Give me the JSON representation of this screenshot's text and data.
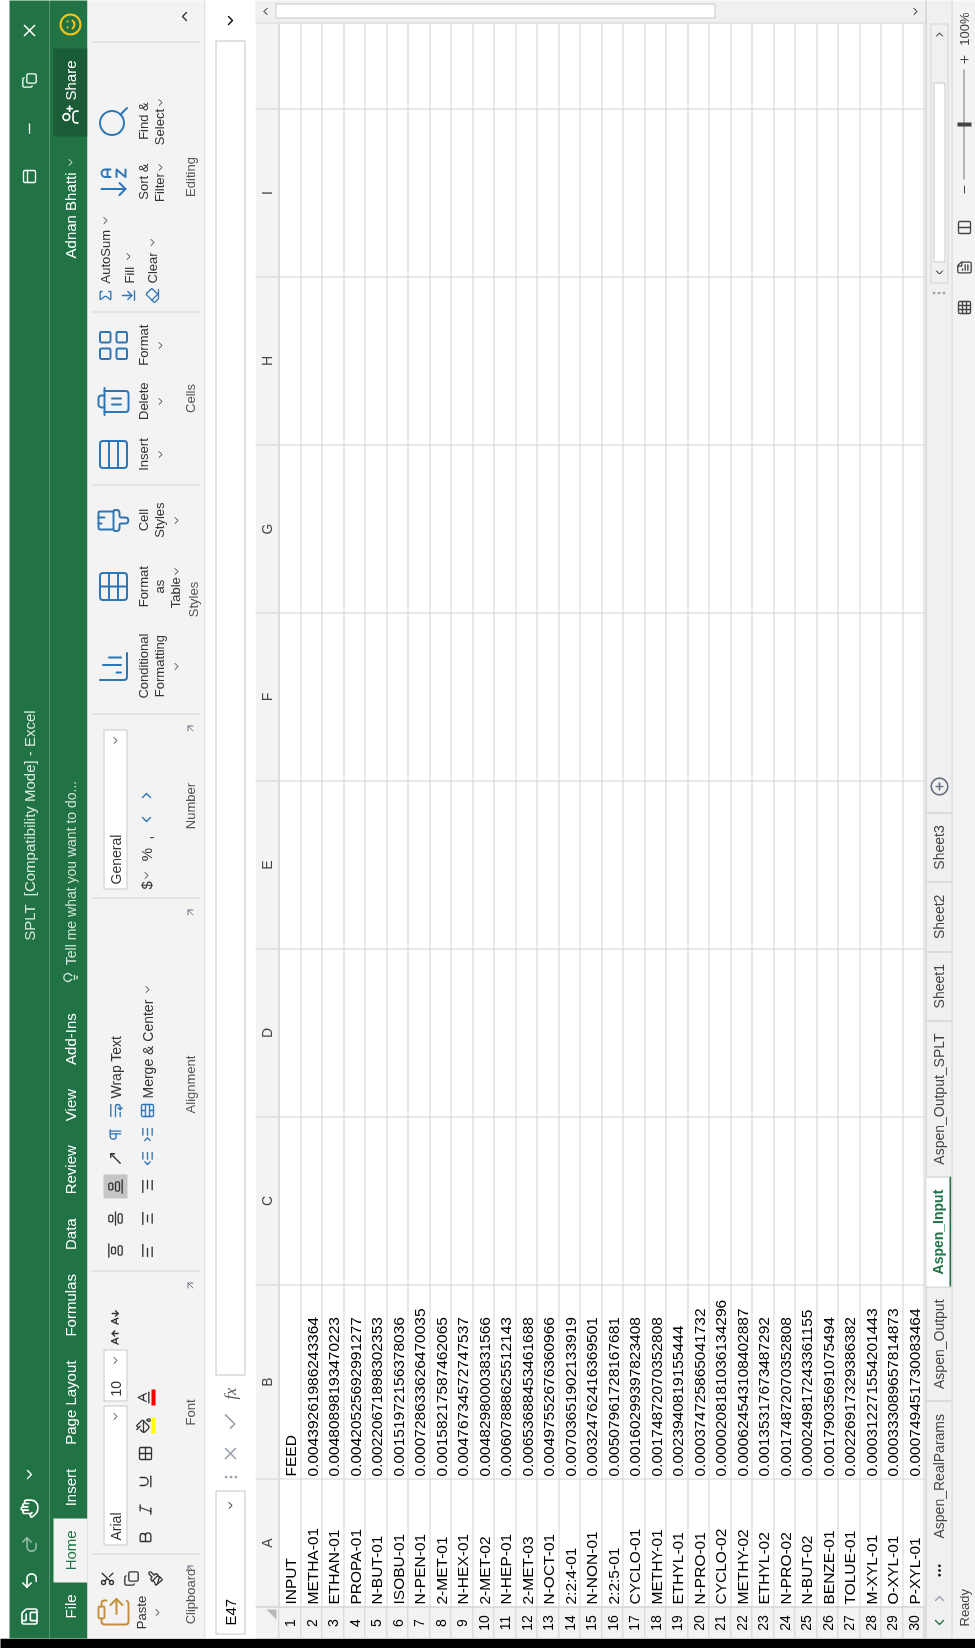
{
  "title_bar": {
    "title": "SPLT  [Compatibility Mode] - Excel"
  },
  "menu_tabs": [
    {
      "label": "File",
      "selected": false
    },
    {
      "label": "Home",
      "selected": true
    },
    {
      "label": "Insert",
      "selected": false
    },
    {
      "label": "Page Layout",
      "selected": false
    },
    {
      "label": "Formulas",
      "selected": false
    },
    {
      "label": "Data",
      "selected": false
    },
    {
      "label": "Review",
      "selected": false
    },
    {
      "label": "View",
      "selected": false
    },
    {
      "label": "Add-Ins",
      "selected": false
    }
  ],
  "tell_me": {
    "placeholder": "Tell me what you want to do..."
  },
  "user": {
    "name": "Adnan Bhatti"
  },
  "share_button": {
    "label": "Share"
  },
  "ribbon": {
    "clipboard": {
      "paste": "Paste",
      "label": "Clipboard"
    },
    "font": {
      "font_name": "Arial",
      "font_size": "10",
      "label": "Font"
    },
    "alignment": {
      "vertical_align": [
        {
          "selected": false
        },
        {
          "selected": false
        },
        {
          "selected": true
        }
      ],
      "wrap_text": "Wrap Text",
      "merge": "Merge & Center",
      "label": "Alignment"
    },
    "number": {
      "format": "General",
      "symbols": [
        "$",
        "%",
        ","
      ],
      "label": "Number"
    },
    "styles": {
      "buttons": [
        {
          "lines": [
            "Conditional",
            "Formatting"
          ]
        },
        {
          "lines": [
            "Format as",
            "Table"
          ]
        },
        {
          "lines": [
            "Cell",
            "Styles"
          ]
        }
      ],
      "label": "Styles"
    },
    "cells": {
      "buttons": [
        "Insert",
        "Delete",
        "Format"
      ],
      "label": "Cells"
    },
    "editing": {
      "small": [
        "AutoSum",
        "Fill",
        "Clear"
      ],
      "buttons": [
        {
          "lines": [
            "Sort &",
            "Filter"
          ]
        },
        {
          "lines": [
            "Find &",
            "Select"
          ]
        }
      ],
      "label": "Editing"
    }
  },
  "formula_bar": {
    "name_box": "E47",
    "function_label": "fx"
  },
  "columns": [
    "A",
    "B",
    "C",
    "D",
    "E",
    "F",
    "G",
    "H",
    "I"
  ],
  "rows": [
    {
      "number": "1",
      "col_a": "INPUT",
      "col_b": "FEED"
    },
    {
      "number": "2",
      "col_a": "METHA-01",
      "col_b": "0.00439261986243364"
    },
    {
      "number": "3",
      "col_a": "ETHAN-01",
      "col_b": "0.00480898193470223"
    },
    {
      "number": "4",
      "col_a": "PROPA-01",
      "col_b": "0.00420525692991277"
    },
    {
      "number": "5",
      "col_a": "N-BUT-01",
      "col_b": "0.00220671898302353"
    },
    {
      "number": "6",
      "col_a": "ISOBU-01",
      "col_b": "0.00151972156378036"
    },
    {
      "number": "7",
      "col_a": "N-PEN-01",
      "col_b": "0.000728633626470035"
    },
    {
      "number": "8",
      "col_a": "2-MET-01",
      "col_b": "0.00158217587462065"
    },
    {
      "number": "9",
      "col_a": "N-HEX-01",
      "col_b": "0.00476734572747537"
    },
    {
      "number": "10",
      "col_a": "2-MET-02",
      "col_b": "0.00482980003831566"
    },
    {
      "number": "11",
      "col_a": "N-HEP-01",
      "col_b": "0.00607888625512143"
    },
    {
      "number": "12",
      "col_a": "2-MET-03",
      "col_b": "0.00653688453461688"
    },
    {
      "number": "13",
      "col_a": "N-OCT-01",
      "col_b": "0.00497552676360966"
    },
    {
      "number": "14",
      "col_a": "2:2:4-01",
      "col_b": "0.00703651902133919"
    },
    {
      "number": "15",
      "col_a": "N-NON-01",
      "col_b": "0.00324762416369501"
    },
    {
      "number": "16",
      "col_a": "2:2:5-01",
      "col_b": "0.00507961728167681"
    },
    {
      "number": "17",
      "col_a": "CYCLO-01",
      "col_b": "0.00160299397823408"
    },
    {
      "number": "18",
      "col_a": "METHY-01",
      "col_b": "0.00174872070352808"
    },
    {
      "number": "19",
      "col_a": "ETHYL-01",
      "col_b": "0.0023940819155444"
    },
    {
      "number": "20",
      "col_a": "N-PRO-01",
      "col_b": "0.000374725865041732"
    },
    {
      "number": "21",
      "col_a": "CYCLO-02",
      "col_b": "0.0000208181036134296"
    },
    {
      "number": "22",
      "col_a": "METHY-02",
      "col_b": "0.000624543108402887"
    },
    {
      "number": "23",
      "col_a": "ETHYL-02",
      "col_b": "0.00135317673487292"
    },
    {
      "number": "24",
      "col_a": "N-PRO-02",
      "col_b": "0.00174872070352808"
    },
    {
      "number": "25",
      "col_a": "N-BUT-02",
      "col_b": "0.000249817243361155"
    },
    {
      "number": "26",
      "col_a": "BENZE-01",
      "col_b": "0.00179035691075494"
    },
    {
      "number": "27",
      "col_a": "TOLUE-01",
      "col_b": "0.00226917329386382"
    },
    {
      "number": "28",
      "col_a": "M-XYL-01",
      "col_b": "0.000312271554201443"
    },
    {
      "number": "29",
      "col_a": "O-XYL-01",
      "col_b": "0.000333089657814873"
    },
    {
      "number": "30",
      "col_a": "P-XYL-01",
      "col_b": "0.000749451730083464"
    }
  ],
  "sheet_tabs": [
    {
      "label": "Aspen_RealParams",
      "selected": false
    },
    {
      "label": "Aspen_Output",
      "selected": false
    },
    {
      "label": "Aspen_Input",
      "selected": true
    },
    {
      "label": "Aspen_Output_SPLT",
      "selected": false
    },
    {
      "label": "Sheet1",
      "selected": false
    },
    {
      "label": "Sheet2",
      "selected": false
    },
    {
      "label": "Sheet3",
      "selected": false
    }
  ],
  "status_bar": {
    "status": "Ready",
    "zoom": {
      "reading": "100%",
      "level": 0.5
    }
  }
}
